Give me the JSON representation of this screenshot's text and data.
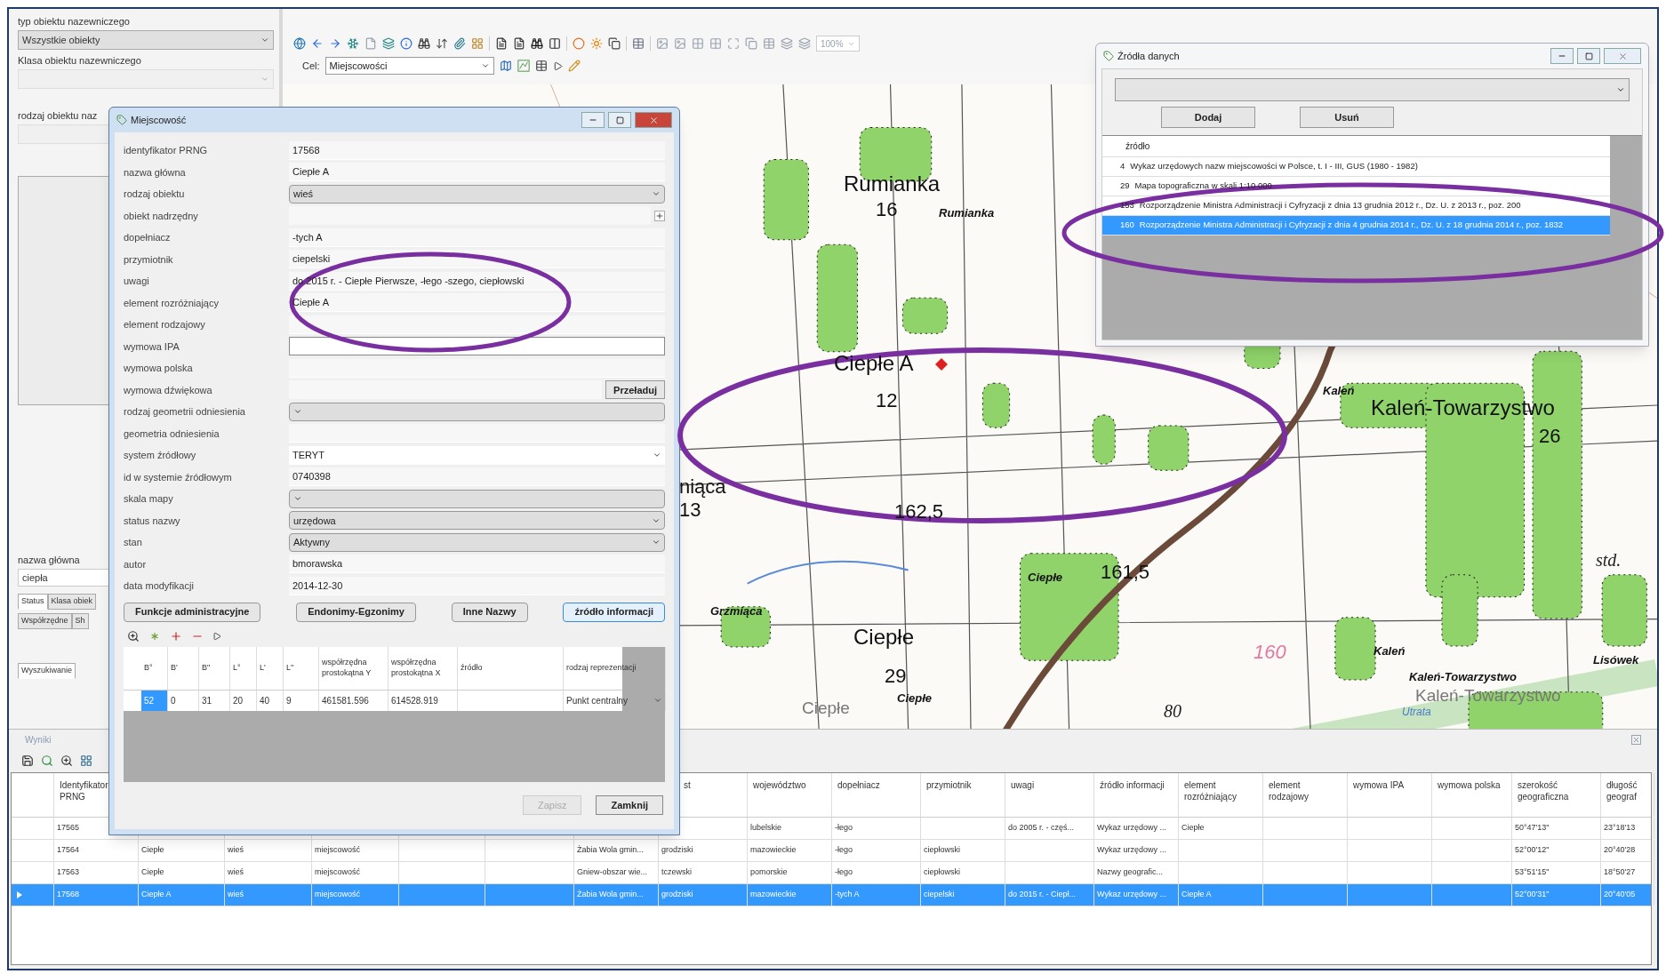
{
  "left_panel": {
    "type_label": "typ obiektu nazewniczego",
    "type_select": "Wszystkie obiekty",
    "class_label": "Klasa obiektu nazewniczego",
    "kind_label": "rodzaj obiektu naz",
    "name_label": "nazwa główna",
    "name_value": "ciepła",
    "tabs": [
      {
        "label": "Status",
        "selected": true
      },
      {
        "label": "Klasa obiek",
        "selected": false
      }
    ],
    "tabs_row2": [
      {
        "label": "Współrzędne",
        "selected": false
      },
      {
        "label": "Sh",
        "selected": false
      }
    ],
    "bottom_tabs": [
      {
        "label": "Wyszukiwanie",
        "selected": true
      }
    ]
  },
  "toolbar": {
    "zoom_value": "100%",
    "target_label": "Cel:",
    "target_value": "Miejscowości"
  },
  "map": {
    "labels": [
      {
        "text": "Rumianka",
        "kind": "large"
      },
      {
        "text": "16",
        "kind": "number"
      },
      {
        "text": "Rumianka",
        "kind": "italic"
      },
      {
        "text": "Ciepłe A",
        "kind": "large"
      },
      {
        "text": "12",
        "kind": "number"
      },
      {
        "text": "162,5",
        "kind": "number"
      },
      {
        "text": "Kaleń",
        "kind": "italic"
      },
      {
        "text": "Kaleń-Towarzystwo",
        "kind": "large"
      },
      {
        "text": "26",
        "kind": "number"
      },
      {
        "text": "std.",
        "kind": "serif"
      },
      {
        "text": "Ciepłe",
        "kind": "italic"
      },
      {
        "text": "161,5",
        "kind": "number"
      },
      {
        "text": "Grzmiąca",
        "kind": "italic"
      },
      {
        "text": "Ciepłe",
        "kind": "large"
      },
      {
        "text": "29",
        "kind": "number"
      },
      {
        "text": "Ciepłe",
        "kind": "italic"
      },
      {
        "text": "Ciepłe",
        "kind": "faded"
      },
      {
        "text": "Kaleń",
        "kind": "italic"
      },
      {
        "text": "160",
        "kind": "elevation"
      },
      {
        "text": "Lisówek",
        "kind": "italic"
      },
      {
        "text": "Kaleń-Towarzystwo",
        "kind": "italic"
      },
      {
        "text": "Kaleń-Towarzystwo",
        "kind": "faded"
      },
      {
        "text": "80",
        "kind": "serif"
      },
      {
        "text": "Utrata",
        "kind": "water"
      },
      {
        "text": "niąca",
        "kind": "number"
      },
      {
        "text": "13",
        "kind": "number"
      }
    ]
  },
  "place_dialog": {
    "title": "Miejscowość",
    "fields": [
      {
        "label": "identyfikator PRNG",
        "value": "17568",
        "kind": "text"
      },
      {
        "label": "nazwa główna",
        "value": "Ciepłe A",
        "kind": "text"
      },
      {
        "label": "rodzaj obiektu",
        "value": "wieś",
        "kind": "select"
      },
      {
        "label": "obiekt nadrzędny",
        "kind": "lookup"
      },
      {
        "label": "dopełniacz",
        "value": "-tych A",
        "kind": "text"
      },
      {
        "label": "przymiotnik",
        "value": "ciepelski",
        "kind": "text"
      },
      {
        "label": "uwagi",
        "value": "do 2015 r. - Ciepłe Pierwsze, -łego -szego, ciepłowski",
        "kind": "text"
      },
      {
        "label": "element rozróżniający",
        "value": "Ciepłe A",
        "kind": "text"
      },
      {
        "label": "element rodzajowy",
        "kind": "text"
      },
      {
        "label": "wymowa IPA",
        "kind": "input"
      },
      {
        "label": "wymowa polska",
        "kind": "text"
      },
      {
        "label": "wymowa dźwiękowa",
        "kind": "reload",
        "button": "Przeładuj"
      },
      {
        "label": "rodzaj geometrii odniesienia",
        "kind": "select"
      },
      {
        "label": "geometria odniesienia",
        "kind": "text"
      },
      {
        "label": "system źródłowy",
        "value": "TERYT",
        "kind": "combo"
      },
      {
        "label": "id w systemie źródłowym",
        "value": "0740398",
        "kind": "text"
      },
      {
        "label": "skala mapy",
        "kind": "select"
      },
      {
        "label": "status nazwy",
        "value": "urzędowa",
        "kind": "select"
      },
      {
        "label": "stan",
        "value": "Aktywny",
        "kind": "select"
      },
      {
        "label": "autor",
        "value": "bmorawska",
        "kind": "text"
      },
      {
        "label": "data modyfikacji",
        "value": "2014-12-30",
        "kind": "text"
      }
    ],
    "buttons": [
      {
        "label": "Funkcje administracyjne",
        "focused": false
      },
      {
        "label": "Endonimy-Egzonimy",
        "focused": false
      },
      {
        "label": "Inne Nazwy",
        "focused": false
      },
      {
        "label": "źródło informacji",
        "focused": true
      }
    ],
    "coords": {
      "columns": [
        "B°",
        "B'",
        "B\"",
        "L°",
        "L'",
        "L\"",
        "współrzędna prostokątna Y",
        "współrzędna prostokątna X",
        "źródło",
        "rodzaj reprezentacji"
      ],
      "cells": [
        {
          "value": "52",
          "selected": true
        },
        {
          "value": "0",
          "selected": false
        },
        {
          "value": "31",
          "selected": false
        },
        {
          "value": "20",
          "selected": false
        },
        {
          "value": "40",
          "selected": false
        },
        {
          "value": "9",
          "selected": false
        },
        {
          "value": "461581.596",
          "selected": false
        },
        {
          "value": "614528.919",
          "selected": false
        },
        {
          "selected": false
        },
        {
          "value": "Punkt centralny",
          "selected": false
        }
      ]
    },
    "save": {
      "label": "Zapisz",
      "disabled": true
    },
    "close": {
      "label": "Zamknij",
      "disabled": false
    }
  },
  "sources_dialog": {
    "title": "Źródła danych",
    "add": "Dodaj",
    "remove": "Usuń",
    "column": "źródło",
    "rows": [
      {
        "id": "4",
        "text": "Wykaz urzędowych nazw miejscowości w Polsce, t. I - III, GUS (1980 - 1982)",
        "selected": false
      },
      {
        "id": "29",
        "text": "Mapa topograficzna w skali 1:10 000",
        "selected": false
      },
      {
        "id": "153",
        "text": "Rozporządzenie Ministra Administracji i Cyfryzacji z dnia 13 grudnia 2012 r., Dz. U. z 2013 r., poz. 200",
        "selected": false
      },
      {
        "id": "160",
        "text": "Rozporządzenie Ministra Administracji i Cyfryzacji z dnia 4 grudnia 2014 r., Dz. U. z 18 grudnia 2014 r., poz. 1832",
        "selected": true
      }
    ]
  },
  "results": {
    "title": "Wyniki",
    "columns": [
      "Identyfikator PRNG",
      null,
      null,
      null,
      null,
      null,
      null,
      "st",
      "województwo",
      "dopełniacz",
      "przymiotnik",
      "uwagi",
      "źródło informacji",
      "element rozróżniający",
      "element rodzajowy",
      "wymowa IPA",
      "wymowa polska",
      "szerokość geograficzna",
      "długość geograf"
    ],
    "rows": [
      {
        "current": false,
        "selected": false,
        "cells": [
          "17565",
          null,
          null,
          null,
          null,
          null,
          null,
          null,
          "lubelskie",
          "-łego",
          null,
          "do 2005 r. - częś...",
          "Wykaz urzędowy ...",
          "Ciepłe",
          null,
          null,
          null,
          "50°47'13\"",
          "23°18'13"
        ]
      },
      {
        "current": false,
        "selected": false,
        "cells": [
          "17564",
          "Ciepłe",
          "wieś",
          "miejscowość",
          null,
          null,
          "Żabia Wola gmin...",
          "grodziski",
          "mazowieckie",
          "-łego",
          "ciepłowski",
          null,
          "Wykaz urzędowy ...",
          null,
          null,
          null,
          null,
          "52°00'12\"",
          "20°40'28"
        ]
      },
      {
        "current": false,
        "selected": false,
        "cells": [
          "17563",
          "Ciepłe",
          "wieś",
          "miejscowość",
          null,
          null,
          "Gniew-obszar wie...",
          "tczewski",
          "pomorskie",
          "-łego",
          "ciepłowski",
          null,
          "Nazwy geografic...",
          null,
          null,
          null,
          null,
          "53°51'15\"",
          "18°50'27"
        ]
      },
      {
        "current": true,
        "selected": true,
        "cells": [
          "17568",
          "Ciepłe A",
          "wieś",
          "miejscowość",
          null,
          null,
          "Żabia Wola gmin...",
          "grodziski",
          "mazowieckie",
          "-tych A",
          "ciepelski",
          "do 2015 r. - Ciepł...",
          "Wykaz urzędowy ...",
          "Ciepłe A",
          null,
          null,
          null,
          "52°00'31\"",
          "20°40'05"
        ]
      }
    ]
  }
}
